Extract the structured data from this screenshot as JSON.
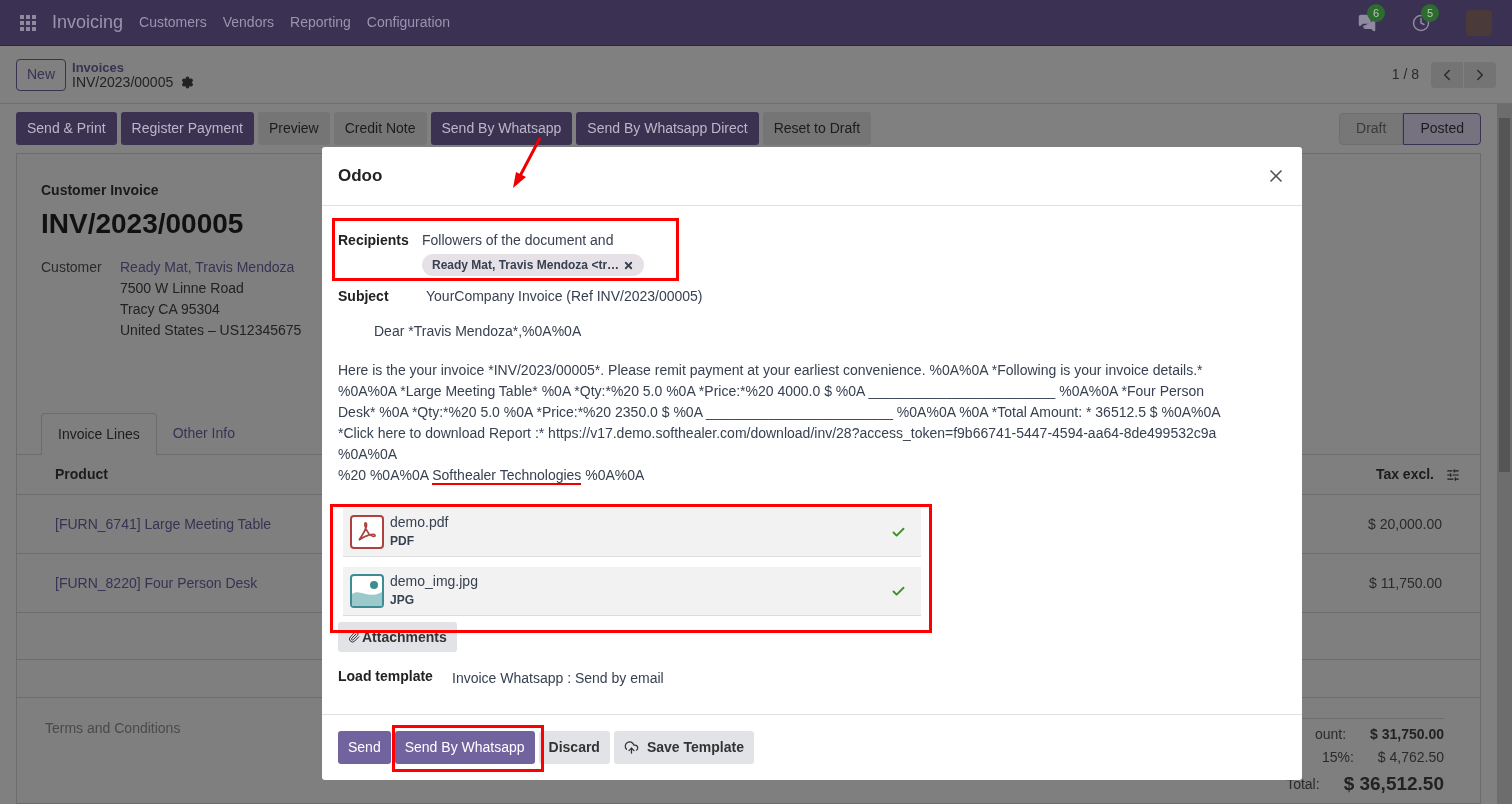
{
  "navbar": {
    "app": "Invoicing",
    "menu": [
      "Customers",
      "Vendors",
      "Reporting",
      "Configuration"
    ],
    "messages_badge": "6",
    "activities_badge": "5"
  },
  "control_panel": {
    "new_button": "New",
    "breadcrumb": "Invoices",
    "record": "INV/2023/00005",
    "pager": "1 / 8"
  },
  "actions": [
    {
      "label": "Send & Print",
      "primary": true
    },
    {
      "label": "Register Payment",
      "primary": true
    },
    {
      "label": "Preview",
      "primary": false
    },
    {
      "label": "Credit Note",
      "primary": false
    },
    {
      "label": "Send By Whatsapp",
      "primary": true
    },
    {
      "label": "Send By Whatsapp Direct",
      "primary": true
    },
    {
      "label": "Reset to Draft",
      "primary": false
    }
  ],
  "status": [
    {
      "label": "Draft",
      "selected": false
    },
    {
      "label": "Posted",
      "selected": true
    }
  ],
  "form": {
    "type": "Customer Invoice",
    "number": "INV/2023/00005",
    "customer_label": "Customer",
    "customer": "Ready Mat, Travis Mendoza",
    "address": [
      "7500 W Linne Road",
      "Tracy CA 95304",
      "United States – US12345675"
    ]
  },
  "tabs": [
    {
      "label": "Invoice Lines",
      "selected": true
    },
    {
      "label": "Other Info",
      "selected": false
    }
  ],
  "table": {
    "columns": [
      "Product",
      "Tax excl."
    ],
    "rows": [
      [
        "[FURN_6741] Large Meeting Table",
        "$ 20,000.00"
      ],
      [
        "[FURN_8220] Four Person Desk",
        "$ 11,750.00"
      ]
    ]
  },
  "terms_placeholder": "Terms and Conditions",
  "totals": [
    {
      "label": "ount:",
      "value": "$ 31,750.00",
      "kind": "subtotal"
    },
    {
      "label": "15%:",
      "value": "$ 4,762.50",
      "kind": "tax"
    },
    {
      "label": "Total:",
      "value": "$ 36,512.50",
      "kind": "total"
    }
  ],
  "dialog": {
    "title": "Odoo",
    "recipients_label": "Recipients",
    "recipients_text": "Followers of the document and",
    "recipient_tag": "Ready Mat, Travis Mendoza <tr…",
    "subject_label": "Subject",
    "subject": "YourCompany Invoice (Ref INV/2023/00005)",
    "greeting": "Dear *Travis Mendoza*,%0A%0A",
    "body": "Here is the your invoice *INV/2023/00005*. Please remit payment at your earliest convenience. %0A%0A *Following is your invoice details.* %0A%0A *Large Meeting Table* %0A *Qty:*%20 5.0 %0A *Price:*%20 4000.0 $ %0A ________________________ %0A%0A *Four Person Desk* %0A *Qty:*%20 5.0 %0A *Price:*%20 2350.0 $ %0A ________________________ %0A%0A %0A *Total Amount: * 36512.5 $ %0A%0A *Click here to download Report :* https://v17.demo.softhealer.com/download/inv/28?access_token=f9b66741-5447-4594-aa64-8de499532c9a %0A%0A",
    "signature": {
      "before": "%20 %0A%0A",
      "highlight": "Softhealer Technologies",
      "after": "%0A%0A"
    },
    "attachments": [
      {
        "name": "demo.pdf",
        "type": "PDF",
        "kind": "pdf"
      },
      {
        "name": "demo_img.jpg",
        "type": "JPG",
        "kind": "image"
      }
    ],
    "attachments_button": "Attachments",
    "template_label": "Load template",
    "template": "Invoice Whatsapp : Send by email",
    "buttons": [
      {
        "label": "Send",
        "primary": true,
        "kind": "plain"
      },
      {
        "label": "Send By Whatsapp",
        "primary": true,
        "kind": "plain"
      },
      {
        "label": "Discard",
        "primary": false,
        "kind": "plain"
      },
      {
        "label": "Save Template",
        "primary": false,
        "kind": "template"
      }
    ]
  }
}
